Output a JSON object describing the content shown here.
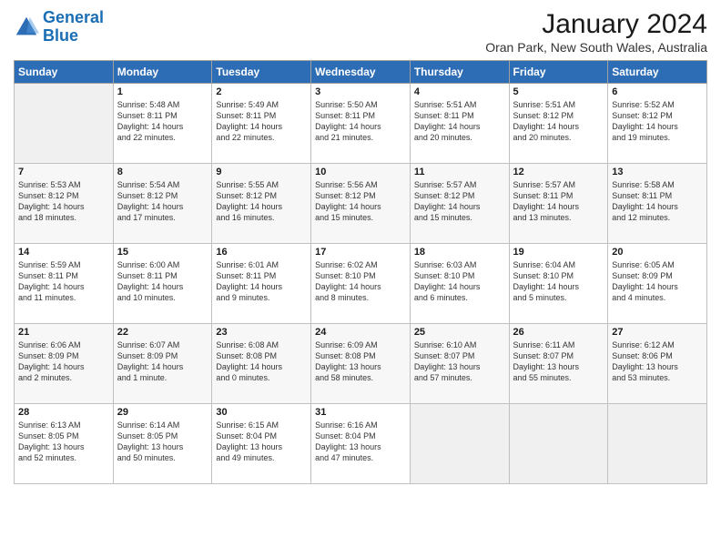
{
  "logo": {
    "line1": "General",
    "line2": "Blue"
  },
  "calendar": {
    "title": "January 2024",
    "subtitle": "Oran Park, New South Wales, Australia"
  },
  "weekdays": [
    "Sunday",
    "Monday",
    "Tuesday",
    "Wednesday",
    "Thursday",
    "Friday",
    "Saturday"
  ],
  "weeks": [
    [
      {
        "day": "",
        "info": ""
      },
      {
        "day": "1",
        "info": "Sunrise: 5:48 AM\nSunset: 8:11 PM\nDaylight: 14 hours\nand 22 minutes."
      },
      {
        "day": "2",
        "info": "Sunrise: 5:49 AM\nSunset: 8:11 PM\nDaylight: 14 hours\nand 22 minutes."
      },
      {
        "day": "3",
        "info": "Sunrise: 5:50 AM\nSunset: 8:11 PM\nDaylight: 14 hours\nand 21 minutes."
      },
      {
        "day": "4",
        "info": "Sunrise: 5:51 AM\nSunset: 8:11 PM\nDaylight: 14 hours\nand 20 minutes."
      },
      {
        "day": "5",
        "info": "Sunrise: 5:51 AM\nSunset: 8:12 PM\nDaylight: 14 hours\nand 20 minutes."
      },
      {
        "day": "6",
        "info": "Sunrise: 5:52 AM\nSunset: 8:12 PM\nDaylight: 14 hours\nand 19 minutes."
      }
    ],
    [
      {
        "day": "7",
        "info": "Sunrise: 5:53 AM\nSunset: 8:12 PM\nDaylight: 14 hours\nand 18 minutes."
      },
      {
        "day": "8",
        "info": "Sunrise: 5:54 AM\nSunset: 8:12 PM\nDaylight: 14 hours\nand 17 minutes."
      },
      {
        "day": "9",
        "info": "Sunrise: 5:55 AM\nSunset: 8:12 PM\nDaylight: 14 hours\nand 16 minutes."
      },
      {
        "day": "10",
        "info": "Sunrise: 5:56 AM\nSunset: 8:12 PM\nDaylight: 14 hours\nand 15 minutes."
      },
      {
        "day": "11",
        "info": "Sunrise: 5:57 AM\nSunset: 8:12 PM\nDaylight: 14 hours\nand 15 minutes."
      },
      {
        "day": "12",
        "info": "Sunrise: 5:57 AM\nSunset: 8:11 PM\nDaylight: 14 hours\nand 13 minutes."
      },
      {
        "day": "13",
        "info": "Sunrise: 5:58 AM\nSunset: 8:11 PM\nDaylight: 14 hours\nand 12 minutes."
      }
    ],
    [
      {
        "day": "14",
        "info": "Sunrise: 5:59 AM\nSunset: 8:11 PM\nDaylight: 14 hours\nand 11 minutes."
      },
      {
        "day": "15",
        "info": "Sunrise: 6:00 AM\nSunset: 8:11 PM\nDaylight: 14 hours\nand 10 minutes."
      },
      {
        "day": "16",
        "info": "Sunrise: 6:01 AM\nSunset: 8:11 PM\nDaylight: 14 hours\nand 9 minutes."
      },
      {
        "day": "17",
        "info": "Sunrise: 6:02 AM\nSunset: 8:10 PM\nDaylight: 14 hours\nand 8 minutes."
      },
      {
        "day": "18",
        "info": "Sunrise: 6:03 AM\nSunset: 8:10 PM\nDaylight: 14 hours\nand 6 minutes."
      },
      {
        "day": "19",
        "info": "Sunrise: 6:04 AM\nSunset: 8:10 PM\nDaylight: 14 hours\nand 5 minutes."
      },
      {
        "day": "20",
        "info": "Sunrise: 6:05 AM\nSunset: 8:09 PM\nDaylight: 14 hours\nand 4 minutes."
      }
    ],
    [
      {
        "day": "21",
        "info": "Sunrise: 6:06 AM\nSunset: 8:09 PM\nDaylight: 14 hours\nand 2 minutes."
      },
      {
        "day": "22",
        "info": "Sunrise: 6:07 AM\nSunset: 8:09 PM\nDaylight: 14 hours\nand 1 minute."
      },
      {
        "day": "23",
        "info": "Sunrise: 6:08 AM\nSunset: 8:08 PM\nDaylight: 14 hours\nand 0 minutes."
      },
      {
        "day": "24",
        "info": "Sunrise: 6:09 AM\nSunset: 8:08 PM\nDaylight: 13 hours\nand 58 minutes."
      },
      {
        "day": "25",
        "info": "Sunrise: 6:10 AM\nSunset: 8:07 PM\nDaylight: 13 hours\nand 57 minutes."
      },
      {
        "day": "26",
        "info": "Sunrise: 6:11 AM\nSunset: 8:07 PM\nDaylight: 13 hours\nand 55 minutes."
      },
      {
        "day": "27",
        "info": "Sunrise: 6:12 AM\nSunset: 8:06 PM\nDaylight: 13 hours\nand 53 minutes."
      }
    ],
    [
      {
        "day": "28",
        "info": "Sunrise: 6:13 AM\nSunset: 8:05 PM\nDaylight: 13 hours\nand 52 minutes."
      },
      {
        "day": "29",
        "info": "Sunrise: 6:14 AM\nSunset: 8:05 PM\nDaylight: 13 hours\nand 50 minutes."
      },
      {
        "day": "30",
        "info": "Sunrise: 6:15 AM\nSunset: 8:04 PM\nDaylight: 13 hours\nand 49 minutes."
      },
      {
        "day": "31",
        "info": "Sunrise: 6:16 AM\nSunset: 8:04 PM\nDaylight: 13 hours\nand 47 minutes."
      },
      {
        "day": "",
        "info": ""
      },
      {
        "day": "",
        "info": ""
      },
      {
        "day": "",
        "info": ""
      }
    ]
  ]
}
